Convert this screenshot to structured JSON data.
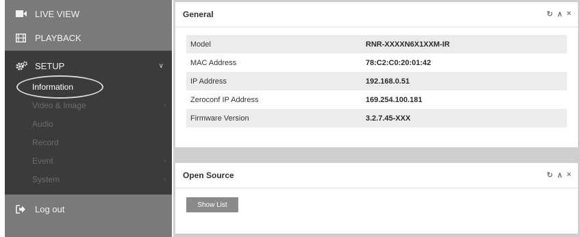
{
  "sidebar": {
    "live_view": "LIVE VIEW",
    "playback": "PLAYBACK",
    "setup": "SETUP",
    "setup_items": [
      {
        "label": "Information",
        "active": true,
        "has_arrow": false
      },
      {
        "label": "Video & Image",
        "active": false,
        "has_arrow": true
      },
      {
        "label": "Audio",
        "active": false,
        "has_arrow": false
      },
      {
        "label": "Record",
        "active": false,
        "has_arrow": false
      },
      {
        "label": "Event",
        "active": false,
        "has_arrow": true
      },
      {
        "label": "System",
        "active": false,
        "has_arrow": true
      }
    ],
    "logout": "Log out",
    "icons": {
      "live_view": "camera-icon",
      "playback": "film-icon",
      "setup": "gears-icon",
      "logout": "logout-icon"
    }
  },
  "general": {
    "title": "General",
    "rows": [
      {
        "label": "Model",
        "value": "RNR-XXXXN6X1XXM-IR"
      },
      {
        "label": "MAC Address",
        "value": "78:C2:C0:20:01:42"
      },
      {
        "label": "IP Address",
        "value": "192.168.0.51"
      },
      {
        "label": "Zeroconf IP Address",
        "value": "169.254.100.181"
      },
      {
        "label": "Firmware Version",
        "value": "3.2.7.45-XXX"
      }
    ]
  },
  "open_source": {
    "title": "Open Source",
    "button": "Show List"
  },
  "panel_tools": {
    "refresh": "↻",
    "collapse": "∧",
    "close": "×"
  },
  "colors": {
    "sidebar": "#7a7a7a",
    "setup_bg": "#3b3b3b",
    "content_bg": "#cfcfcf"
  }
}
